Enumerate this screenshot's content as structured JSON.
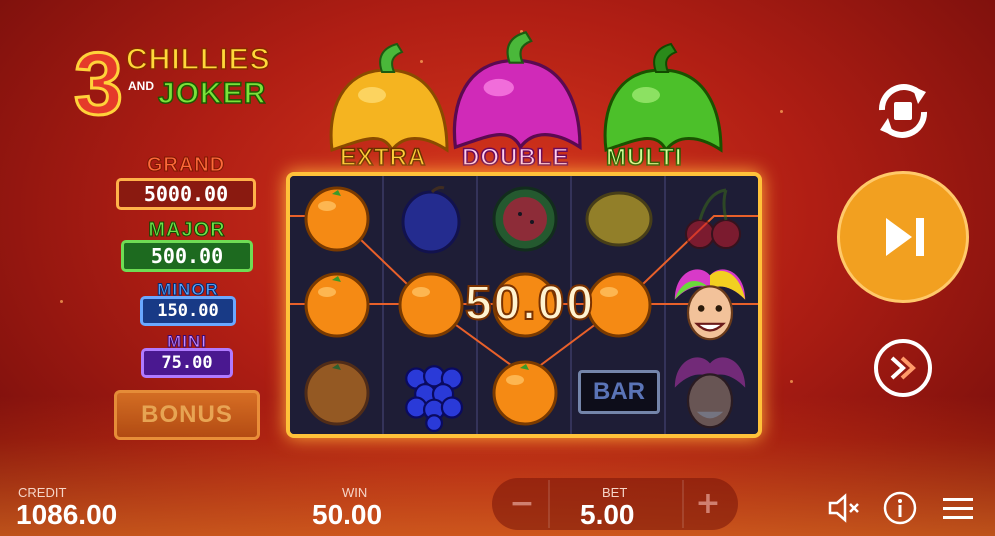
{
  "logo": {
    "number": "3",
    "line1": "CHILLIES",
    "and": "AND",
    "line2": "JOKER"
  },
  "jackpots": [
    {
      "name": "GRAND",
      "value": "5000.00",
      "color": "#e8402a"
    },
    {
      "name": "MAJOR",
      "value": "500.00",
      "color": "#2fa83a"
    },
    {
      "name": "MINOR",
      "value": "150.00",
      "color": "#2f6fd8"
    },
    {
      "name": "MINI",
      "value": "75.00",
      "color": "#7a2ad8"
    }
  ],
  "bonus_label": "BONUS",
  "banners": {
    "extra": "EXTRA",
    "double": "DOUBLE",
    "multi": "MULTI"
  },
  "reels": [
    [
      "orange",
      "orange",
      "orange"
    ],
    [
      "plum",
      "orange",
      "grapes"
    ],
    [
      "watermelon",
      "orange",
      "orange"
    ],
    [
      "lemon",
      "orange",
      "bar"
    ],
    [
      "cherry",
      "joker",
      "joker"
    ]
  ],
  "bar_label": "BAR",
  "win_popup": "50.00",
  "bottom": {
    "credit_label": "CREDIT",
    "credit_value": "1086.00",
    "win_label": "WIN",
    "win_value": "50.00",
    "bet_label": "BET",
    "bet_value": "5.00",
    "bet_minus": "−",
    "bet_plus": "+"
  },
  "icons": [
    "autoplay-icon",
    "spin-icon",
    "turbo-icon",
    "sound-off-icon",
    "info-icon",
    "menu-icon"
  ]
}
